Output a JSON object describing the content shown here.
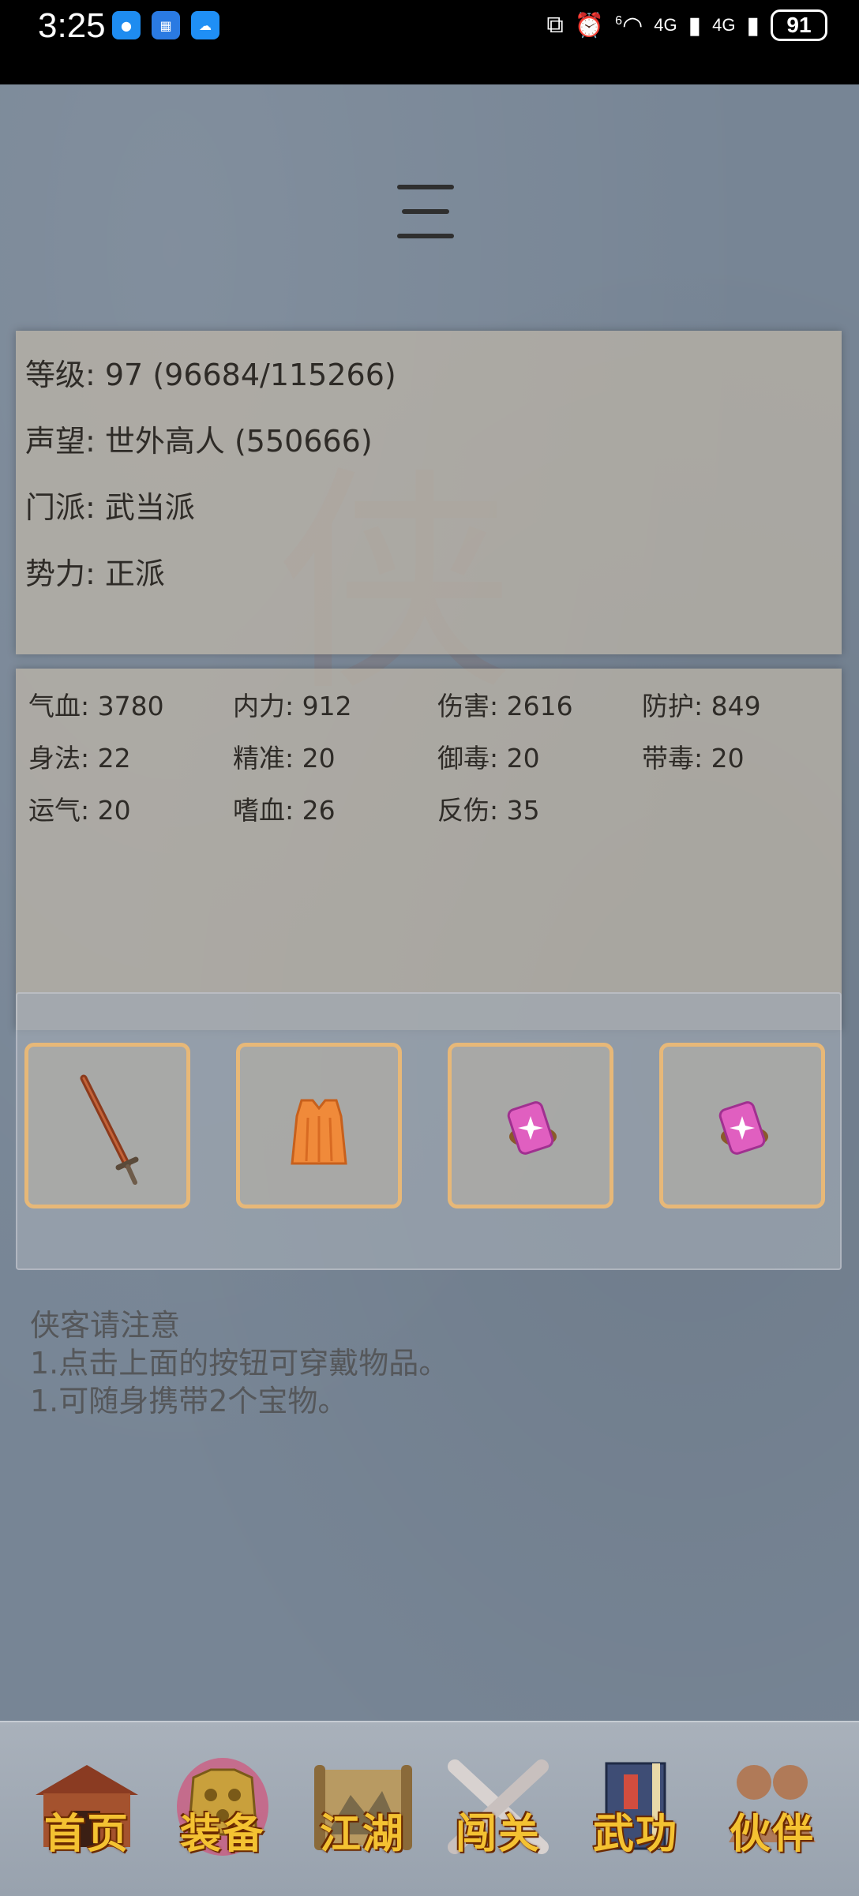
{
  "status_bar": {
    "time": "3:25",
    "network_1": "4G",
    "network_2": "4G",
    "wifi_label": "6",
    "battery": "91"
  },
  "character": {
    "level_label": "等级: 97 (96684/115266)",
    "reputation_label": "声望: 世外高人 (550666)",
    "sect_label": "门派: 武当派",
    "faction_label": "势力:  正派"
  },
  "stats": [
    "气血: 3780",
    "内力: 912",
    "伤害: 2616",
    "防护: 849",
    "身法: 22",
    "精准: 20",
    "御毒: 20",
    "带毒: 20",
    "运气: 20",
    "嗜血: 26",
    "反伤: 35"
  ],
  "equipment_slots": [
    {
      "item": "sword-icon"
    },
    {
      "item": "robe-icon"
    },
    {
      "item": "treasure-icon"
    },
    {
      "item": "treasure-icon"
    }
  ],
  "notes": {
    "title": "侠客请注意",
    "line1": "1.点击上面的按钮可穿戴物品。",
    "line2": "1.可随身携带2个宝物。"
  },
  "bottom_nav": {
    "home": "首页",
    "equipment": "装备",
    "jianghu": "江湖",
    "challenge": "闯关",
    "martial": "武功",
    "partner": "伙伴"
  },
  "colors": {
    "slot_border": "#e7b878",
    "nav_label": "#f4c232",
    "panel": "#bdb6a8"
  }
}
